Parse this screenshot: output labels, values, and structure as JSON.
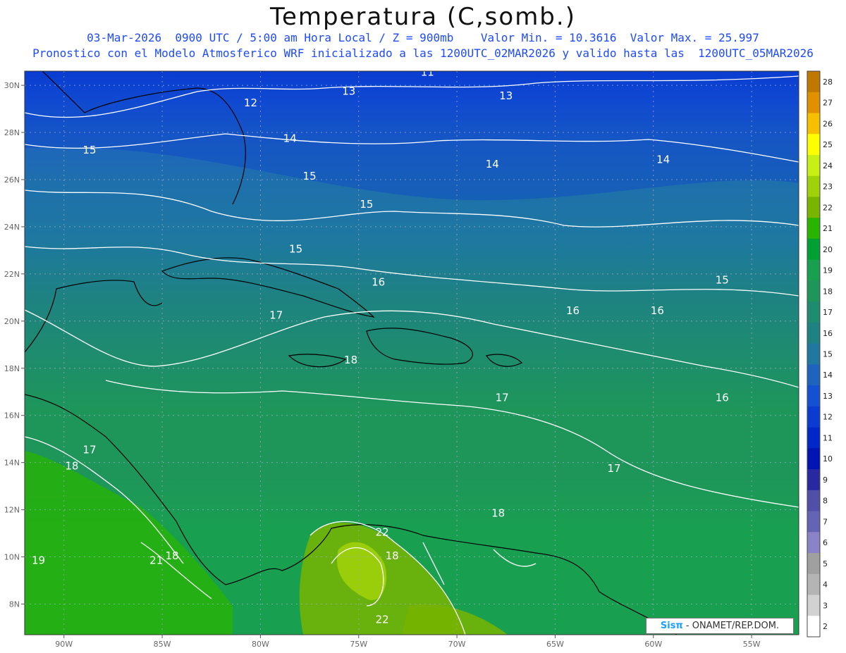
{
  "header": {
    "title": "Temperatura (C,somb.)",
    "line1": "03-Mar-2026  0900 UTC / 5:00 am Hora Local / Z = 900mb    Valor Min. = 10.3616  Valor Max. = 25.997",
    "line2": "Pronostico con el Modelo Atmosferico WRF inicializado a las 1200UTC_02MAR2026 y valido hasta las  1200UTC_05MAR2026"
  },
  "map": {
    "lat_labels": [
      "30N",
      "28N",
      "26N",
      "24N",
      "22N",
      "20N",
      "18N",
      "16N",
      "14N",
      "12N",
      "10N",
      "8N"
    ],
    "lat_values": [
      30,
      28,
      26,
      24,
      22,
      20,
      18,
      16,
      14,
      12,
      10,
      8
    ],
    "lon_labels": [
      "90W",
      "85W",
      "80W",
      "75W",
      "70W",
      "65W",
      "60W",
      "55W"
    ],
    "lon_values": [
      -90,
      -85,
      -80,
      -75,
      -70,
      -65,
      -60,
      -55
    ],
    "contour_labels": [
      {
        "text": "11",
        "lon": -71.5,
        "lat": 30.4
      },
      {
        "text": "13",
        "lon": -75.5,
        "lat": 29.6
      },
      {
        "text": "13",
        "lon": -67.5,
        "lat": 29.4
      },
      {
        "text": "12",
        "lon": -80.5,
        "lat": 29.1
      },
      {
        "text": "14",
        "lon": -78.5,
        "lat": 27.6
      },
      {
        "text": "15",
        "lon": -88.7,
        "lat": 27.1
      },
      {
        "text": "14",
        "lon": -68.2,
        "lat": 26.5
      },
      {
        "text": "14",
        "lon": -59.5,
        "lat": 26.7
      },
      {
        "text": "15",
        "lon": -77.5,
        "lat": 26.0
      },
      {
        "text": "15",
        "lon": -74.6,
        "lat": 24.8
      },
      {
        "text": "15",
        "lon": -78.2,
        "lat": 22.9
      },
      {
        "text": "16",
        "lon": -74.0,
        "lat": 21.5
      },
      {
        "text": "15",
        "lon": -56.5,
        "lat": 21.6
      },
      {
        "text": "16",
        "lon": -64.1,
        "lat": 20.3
      },
      {
        "text": "16",
        "lon": -59.8,
        "lat": 20.3
      },
      {
        "text": "17",
        "lon": -79.2,
        "lat": 20.1
      },
      {
        "text": "18",
        "lon": -75.4,
        "lat": 18.2
      },
      {
        "text": "17",
        "lon": -67.7,
        "lat": 16.6
      },
      {
        "text": "16",
        "lon": -56.5,
        "lat": 16.6
      },
      {
        "text": "17",
        "lon": -88.7,
        "lat": 14.4
      },
      {
        "text": "18",
        "lon": -89.6,
        "lat": 13.7
      },
      {
        "text": "17",
        "lon": -62.0,
        "lat": 13.6
      },
      {
        "text": "18",
        "lon": -67.9,
        "lat": 11.7
      },
      {
        "text": "22",
        "lon": -73.8,
        "lat": 10.9
      },
      {
        "text": "18",
        "lon": -73.3,
        "lat": 9.9
      },
      {
        "text": "18",
        "lon": -84.5,
        "lat": 9.9
      },
      {
        "text": "21",
        "lon": -85.3,
        "lat": 9.7
      },
      {
        "text": "19",
        "lon": -91.3,
        "lat": 9.7
      },
      {
        "text": "22",
        "lon": -73.8,
        "lat": 7.2
      }
    ]
  },
  "colorbar": {
    "labels": [
      "28",
      "27",
      "26",
      "25",
      "24",
      "23",
      "22",
      "21",
      "20",
      "19",
      "18",
      "17",
      "16",
      "15",
      "14",
      "13",
      "12",
      "11",
      "10",
      "9",
      "8",
      "7",
      "6",
      "5",
      "4",
      "3",
      "2"
    ],
    "colors": [
      "#C07800",
      "#E09000",
      "#F6C000",
      "#FFFF00",
      "#C8F014",
      "#A0D20A",
      "#78B400",
      "#28B400",
      "#00A032",
      "#18A050",
      "#1E965A",
      "#1E8C6E",
      "#1E8282",
      "#1E78A0",
      "#1E64BE",
      "#1450D2",
      "#0A3CD2",
      "#0028C8",
      "#0014B4",
      "#2828A0",
      "#5050A8",
      "#6464B4",
      "#8C82C8",
      "#A0A0A0",
      "#B4B4B4",
      "#D2D2D2",
      "#FFFFFF"
    ]
  },
  "watermark": {
    "logo": "Sis",
    "pi": "π",
    "org": " - ONAMET/REP.DOM."
  }
}
